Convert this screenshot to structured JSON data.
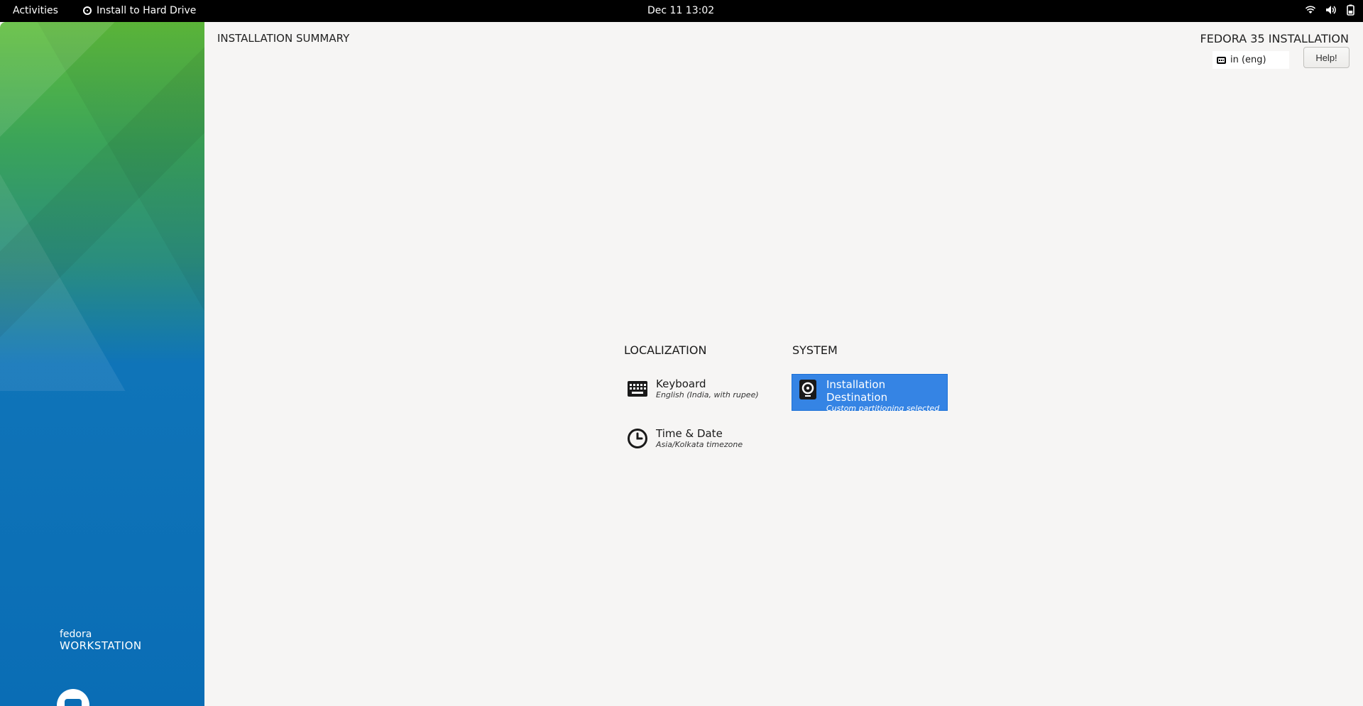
{
  "topbar": {
    "activities": "Activities",
    "app_name": "Install to Hard Drive",
    "clock": "Dec 11  13:02",
    "icons": [
      "wifi-icon",
      "volume-icon",
      "battery-icon"
    ]
  },
  "sidebar": {
    "brand_line1": "fedora",
    "brand_line2": "WORKSTATION",
    "colors": {
      "top": "#5fbd3b",
      "bottom": "#0a6db5"
    }
  },
  "header": {
    "title": "INSTALLATION SUMMARY",
    "product": "FEDORA 35 INSTALLATION",
    "keyboard_layout": "in (eng)",
    "help_label": "Help!"
  },
  "hub": {
    "localization": {
      "title": "LOCALIZATION",
      "spokes": [
        {
          "name": "Keyboard",
          "status": "English (India, with rupee)",
          "icon": "keyboard-icon"
        },
        {
          "name": "Time & Date",
          "status": "Asia/Kolkata timezone",
          "icon": "clock-icon"
        }
      ]
    },
    "system": {
      "title": "SYSTEM",
      "spokes": [
        {
          "name": "Installation Destination",
          "status": "Custom partitioning selected",
          "icon": "disk-icon"
        }
      ]
    },
    "selected_color": "#3584e4"
  }
}
